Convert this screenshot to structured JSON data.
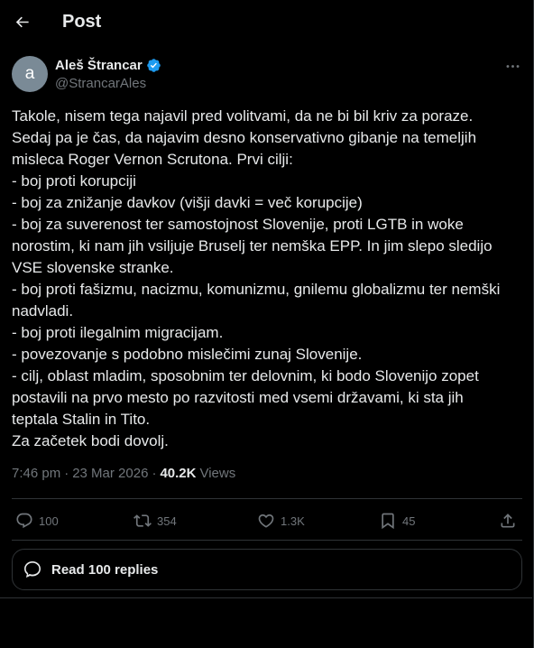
{
  "header": {
    "title": "Post"
  },
  "author": {
    "avatar_letter": "a",
    "name": "Aleš Štrancar",
    "handle": "@StrancarAles"
  },
  "tweet": {
    "lines": [
      "Takole, nisem tega najavil pred volitvami, da ne bi bil kriv za poraze.",
      "Sedaj pa je čas, da najavim desno konservativno gibanje na temeljih",
      "misleca Roger Vernon Scrutona. Prvi cilji:",
      "- boj proti korupciji",
      "- boj za znižanje davkov (višji davki = več korupcije)",
      "- boj za suverenost ter samostojnost Slovenije, proti LGTB in woke",
      "norostim, ki nam jih vsiljuje Bruselj ter nemška EPP. In jim slepo sledijo",
      "VSE slovenske stranke.",
      "- boj proti fašizmu, nacizmu, komunizmu, gnilemu globalizmu ter nemški",
      "nadvladi.",
      "- boj proti ilegalnim migracijam.",
      "- povezovanje s podobno mislečimi zunaj Slovenije.",
      "- cilj, oblast mladim, sposobnim ter delovnim, ki bodo Slovenijo zopet",
      "postavili na prvo mesto po razvitosti med vsemi državami, ki sta jih",
      "teptala Stalin in Tito.",
      "Za začetek bodi dovolj."
    ]
  },
  "meta": {
    "time": "7:46 pm",
    "separator": "·",
    "date": "23 Mar 2026",
    "views_count": "40.2K",
    "views_label": "Views"
  },
  "actions": {
    "replies": "100",
    "reposts": "354",
    "likes": "1.3K",
    "bookmarks": "45"
  },
  "read_replies": {
    "label": "Read 100 replies"
  },
  "colors": {
    "background": "#000000",
    "text": "#e7e9ea",
    "secondary": "#71767b",
    "border": "#2f3336",
    "verified": "#1d9bf0"
  },
  "icons": {
    "back": "arrow-left-icon",
    "verified": "verified-badge-icon",
    "more": "more-horizontal-icon",
    "reply": "comment-bubble-icon",
    "repost": "repost-arrows-icon",
    "like": "heart-icon",
    "bookmark": "bookmark-icon",
    "share": "share-upload-icon",
    "replies": "chat-bubble-icon"
  }
}
